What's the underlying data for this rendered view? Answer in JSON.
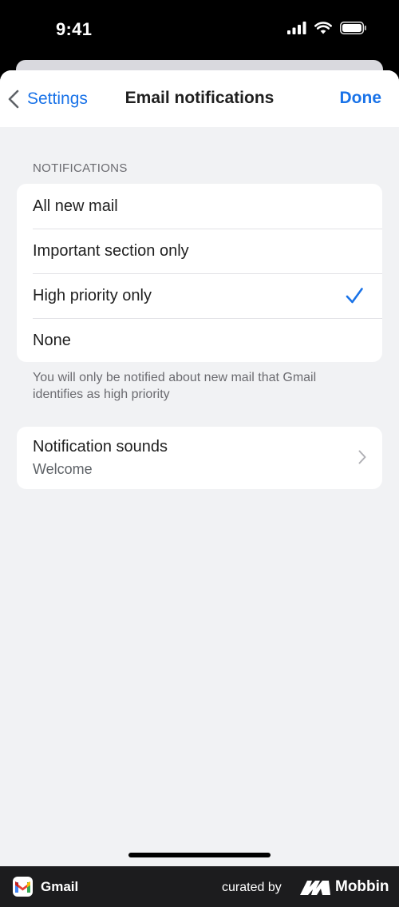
{
  "status_bar": {
    "time": "9:41"
  },
  "nav": {
    "back_label": "Settings",
    "title": "Email notifications",
    "done_label": "Done"
  },
  "notifications": {
    "section_header": "NOTIFICATIONS",
    "options": [
      {
        "label": "All new mail",
        "selected": false
      },
      {
        "label": "Important section only",
        "selected": false
      },
      {
        "label": "High priority only",
        "selected": true
      },
      {
        "label": "None",
        "selected": false
      }
    ],
    "footer_note": "You will only be notified about new mail that Gmail identifies as high priority"
  },
  "sounds": {
    "title": "Notification sounds",
    "value": "Welcome"
  },
  "footer": {
    "app_name": "Gmail",
    "curated_label": "curated by",
    "brand_name": "Mobbin"
  },
  "colors": {
    "accent": "#1a73e8",
    "background": "#f1f2f4",
    "card": "#ffffff",
    "footer": "#1c1c1e"
  }
}
